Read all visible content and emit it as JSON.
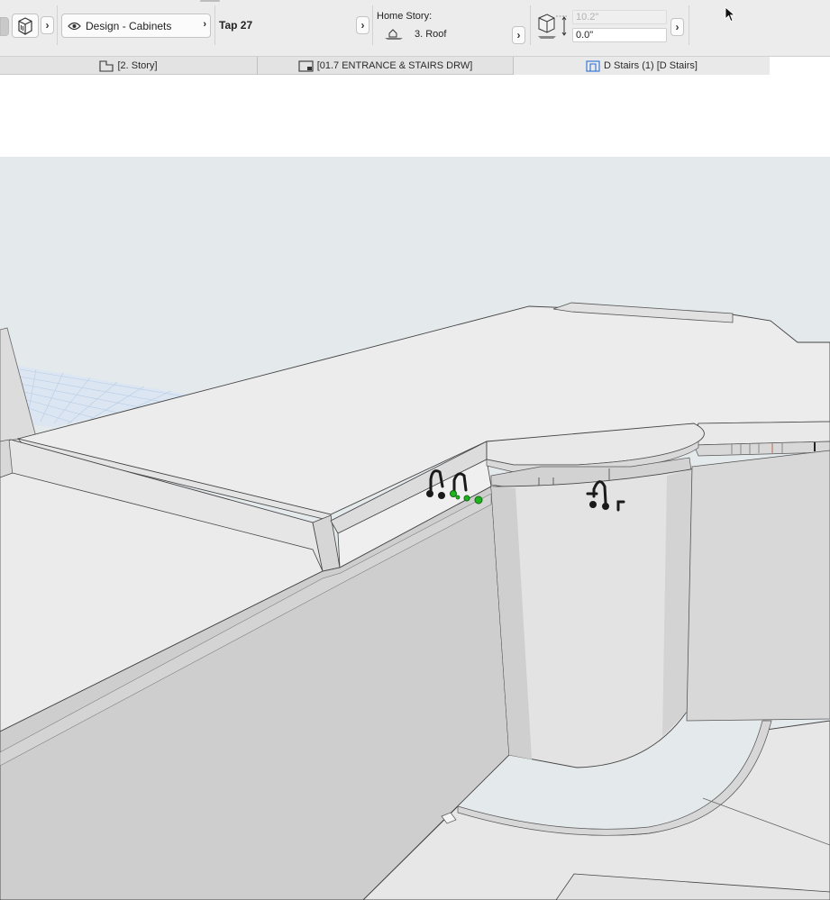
{
  "toolbar": {
    "view_option": "Design - Cabinets",
    "tap_label": "Tap 27",
    "home_story_label": "Home Story:",
    "home_story_value": "3. Roof",
    "elevation_field": "10.2\"",
    "offset_field": "0.0\""
  },
  "tabs": [
    {
      "label": "[2. Story]",
      "icon": "floor-plan-icon"
    },
    {
      "label": "[01.7 ENTRANCE & STAIRS DRW]",
      "icon": "layout-sheet-icon"
    },
    {
      "label": "D Stairs (1) [D Stairs]",
      "icon": "elevation-view-icon"
    }
  ],
  "colors": {
    "sky": "#e4e9ec",
    "surface_light": "#ececec",
    "surface_mid": "#dadada",
    "surface_dark": "#cfcfcf",
    "faucet": "#1a1a1a",
    "selection": "#1fb31f",
    "grid_blue": "#c7d9ee"
  }
}
